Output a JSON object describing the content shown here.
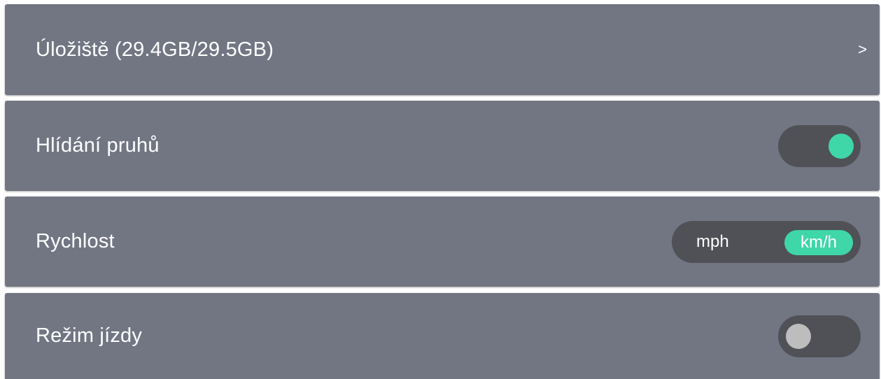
{
  "colors": {
    "accent": "#3fd6a8",
    "row_background": "#727683",
    "control_background": "#4f5156",
    "knob_off": "#bdbdbd"
  },
  "settings": {
    "storage": {
      "label": "Úložiště (29.4GB/29.5GB)",
      "chevron": ">"
    },
    "lane_assist": {
      "label": "Hlídání pruhů",
      "toggle_on": true
    },
    "speed": {
      "label": "Rychlost",
      "options": [
        "mph",
        "km/h"
      ],
      "selected": "km/h"
    },
    "driving_mode": {
      "label": "Režim jízdy",
      "toggle_on": false
    }
  }
}
